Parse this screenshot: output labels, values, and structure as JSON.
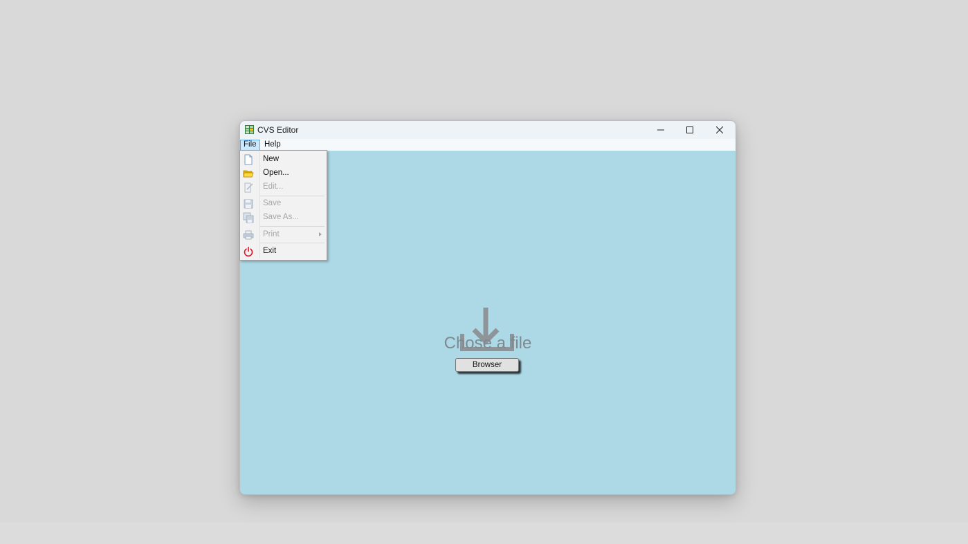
{
  "window": {
    "title": "CVS Editor",
    "icon": "spreadsheet-app-icon",
    "controls": [
      "minimize-icon",
      "maximize-icon",
      "close-icon"
    ]
  },
  "menubar": {
    "file": "File",
    "help": "Help"
  },
  "file_menu": {
    "new": "New",
    "open": "Open...",
    "edit": "Edit...",
    "save": "Save",
    "save_as": "Save As...",
    "print": "Print",
    "exit": "Exit"
  },
  "main": {
    "icon": "download-icon",
    "prompt": "Chose a file",
    "browse_button": "Browser"
  },
  "colors": {
    "content_bg": "#add8e6",
    "desktop_bg": "#d9d9d9",
    "menu_active": "#cce8ff",
    "exit_icon": "#e81123"
  }
}
